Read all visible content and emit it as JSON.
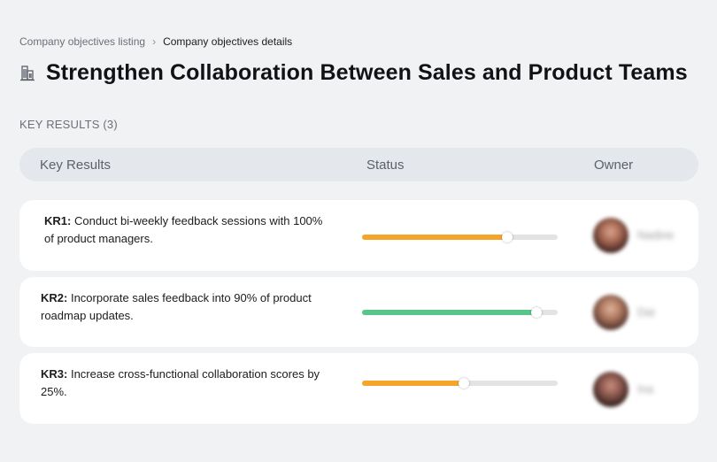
{
  "breadcrumb": {
    "parent": "Company objectives listing",
    "separator": "›",
    "current": "Company objectives details"
  },
  "header": {
    "title": "Strengthen Collaboration Between Sales and Product Teams",
    "icon": "building-icon"
  },
  "key_results_section": {
    "label": "KEY RESULTS (3)"
  },
  "table": {
    "columns": [
      "Key Results",
      "Status",
      "Owner"
    ]
  },
  "key_results": [
    {
      "code": "KR1:",
      "text": "Conduct bi-weekly feedback sessions with 100% of product managers.",
      "progress": 0.74,
      "color": "#f5a52a",
      "owner": "Nadine"
    },
    {
      "code": "KR2:",
      "text": "Incorporate sales feedback into 90% of product roadmap updates.",
      "progress": 0.89,
      "color": "#58c58a",
      "owner": "Dai"
    },
    {
      "code": "KR3:",
      "text": "Increase cross-functional collaboration scores by 25%.",
      "progress": 0.52,
      "color": "#f5a52a",
      "owner": "Ina"
    }
  ]
}
